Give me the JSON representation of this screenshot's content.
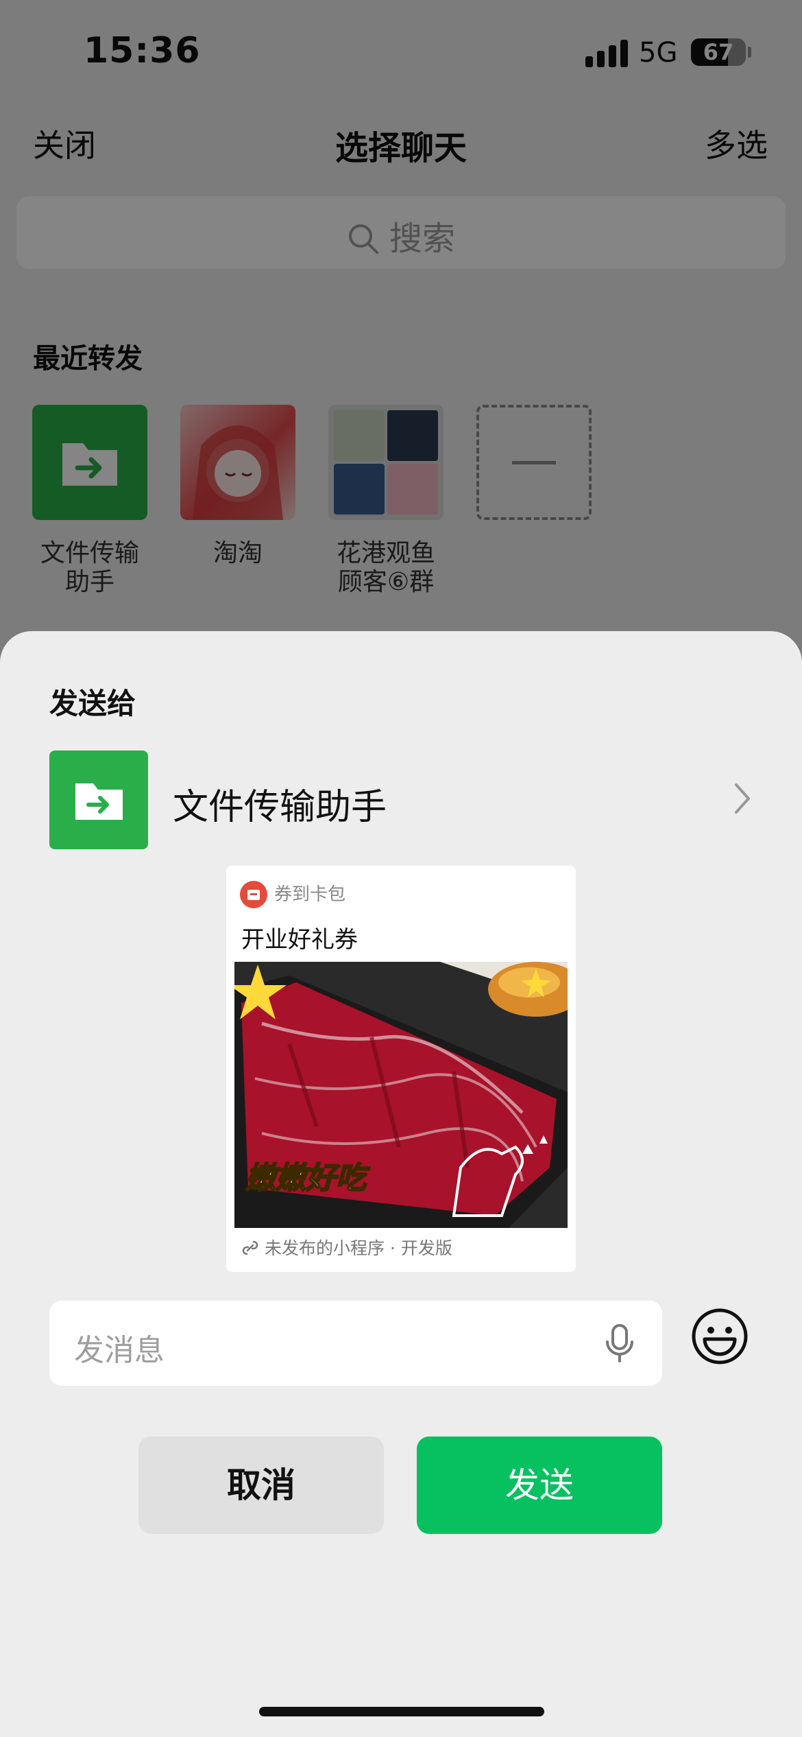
{
  "status_bar": {
    "time": "15:36",
    "network": "5G",
    "battery": "67",
    "battery_level": 0.67
  },
  "nav": {
    "close": "关闭",
    "title": "选择聊天",
    "multi_select": "多选"
  },
  "search": {
    "placeholder": "搜索"
  },
  "recent": {
    "label": "最近转发",
    "items": [
      {
        "name": "文件传输\n助手"
      },
      {
        "name": "淘淘"
      },
      {
        "name": "花港观鱼\n顾客⑥群"
      }
    ]
  },
  "sheet": {
    "title": "发送给",
    "recipient": "文件传输助手",
    "card": {
      "source": "券到卡包",
      "title": "开业好礼券",
      "image_caption": "嫩嫩好吃",
      "footer": "未发布的小程序 · 开发版"
    },
    "message": {
      "placeholder": "发消息"
    },
    "cancel": "取消",
    "send": "发送"
  },
  "colors": {
    "accent": "#07c160",
    "avatar_green": "#2aae4a",
    "badge_red": "#e64a3b"
  }
}
